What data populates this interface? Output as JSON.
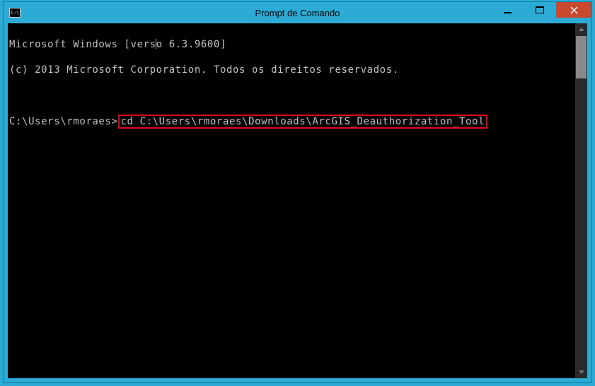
{
  "window": {
    "title": "Prompt de Comando",
    "icon_text": "C:\\"
  },
  "terminal": {
    "line1a": "Microsoft Windows [vers",
    "line1b": "o 6.3.9600]",
    "line2": "(c) 2013 Microsoft Corporation. Todos os direitos reservados.",
    "prompt": "C:\\Users\\rmoraes>",
    "command": "cd C:\\Users\\rmoraes\\Downloads\\ArcGIS_Deauthorization_Tool"
  }
}
